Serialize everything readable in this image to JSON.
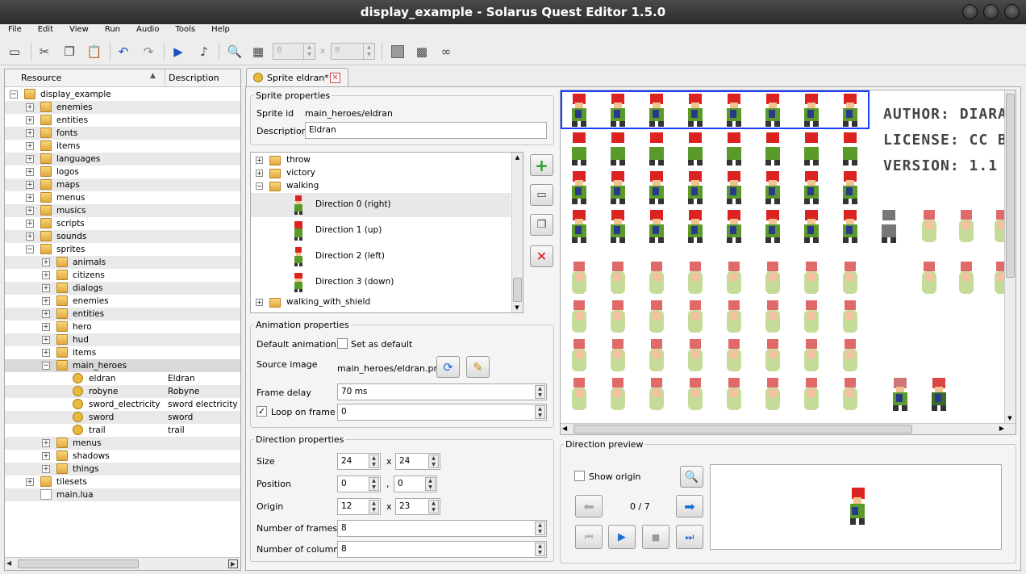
{
  "window": {
    "title": "display_example - Solarus Quest Editor 1.5.0"
  },
  "menu": [
    "File",
    "Edit",
    "View",
    "Run",
    "Audio",
    "Tools",
    "Help"
  ],
  "toolbar": {
    "grid_w": "8",
    "grid_x": "x",
    "grid_h": "8"
  },
  "tree": {
    "col_resource": "Resource",
    "col_description": "Description",
    "root": "display_example",
    "items": [
      {
        "label": "enemies",
        "desc": ""
      },
      {
        "label": "entities",
        "desc": ""
      },
      {
        "label": "fonts",
        "desc": ""
      },
      {
        "label": "items",
        "desc": ""
      },
      {
        "label": "languages",
        "desc": ""
      },
      {
        "label": "logos",
        "desc": ""
      },
      {
        "label": "maps",
        "desc": ""
      },
      {
        "label": "menus",
        "desc": ""
      },
      {
        "label": "musics",
        "desc": ""
      },
      {
        "label": "scripts",
        "desc": ""
      },
      {
        "label": "sounds",
        "desc": ""
      },
      {
        "label": "sprites",
        "desc": ""
      },
      {
        "label": "animals",
        "desc": ""
      },
      {
        "label": "citizens",
        "desc": ""
      },
      {
        "label": "dialogs",
        "desc": ""
      },
      {
        "label": "enemies",
        "desc": ""
      },
      {
        "label": "entities",
        "desc": ""
      },
      {
        "label": "hero",
        "desc": ""
      },
      {
        "label": "hud",
        "desc": ""
      },
      {
        "label": "items",
        "desc": ""
      },
      {
        "label": "main_heroes",
        "desc": ""
      },
      {
        "label": "eldran",
        "desc": "Eldran"
      },
      {
        "label": "robyne",
        "desc": "Robyne"
      },
      {
        "label": "sword_electricity",
        "desc": "sword electricity"
      },
      {
        "label": "sword",
        "desc": "sword"
      },
      {
        "label": "trail",
        "desc": "trail"
      },
      {
        "label": "menus",
        "desc": ""
      },
      {
        "label": "shadows",
        "desc": ""
      },
      {
        "label": "things",
        "desc": ""
      },
      {
        "label": "tilesets",
        "desc": ""
      },
      {
        "label": "main.lua",
        "desc": ""
      }
    ]
  },
  "tab": {
    "label": "Sprite eldran*"
  },
  "sprite_props": {
    "title": "Sprite properties",
    "id_label": "Sprite id",
    "id_value": "main_heroes/eldran",
    "desc_label": "Description",
    "desc_value": "Eldran"
  },
  "anim_tree": {
    "throw": "throw",
    "victory": "victory",
    "walking": "walking",
    "dir0": "Direction 0 (right)",
    "dir1": "Direction 1 (up)",
    "dir2": "Direction 2 (left)",
    "dir3": "Direction 3 (down)",
    "walking_shield": "walking_with_shield"
  },
  "anim_props": {
    "title": "Animation properties",
    "default_label": "Default animation",
    "default_check": "Set as default",
    "source_label": "Source image",
    "source_value": "main_heroes/eldran.png",
    "delay_label": "Frame delay",
    "delay_value": "70 ms",
    "loop_label": "Loop on frame",
    "loop_value": "0"
  },
  "dir_props": {
    "title": "Direction properties",
    "size_label": "Size",
    "size_w": "24",
    "size_h": "24",
    "pos_label": "Position",
    "pos_x": "0",
    "pos_y": "0",
    "origin_label": "Origin",
    "origin_x": "12",
    "origin_y": "23",
    "frames_label": "Number of frames",
    "frames_value": "8",
    "cols_label": "Number of columns",
    "cols_value": "8",
    "x_sep": "x",
    "comma_sep": ","
  },
  "sheet_text": {
    "author": "AUTHOR: DIARA",
    "license": "LICENSE: CC BY",
    "version": "VERSION: 1.1"
  },
  "preview": {
    "title": "Direction preview",
    "show_origin": "Show origin",
    "frame_counter": "0 / 7"
  },
  "colors": {
    "accent": "#1c4fc4",
    "selection_frame": "#1a3cff",
    "tab_close": "#cc4444"
  }
}
